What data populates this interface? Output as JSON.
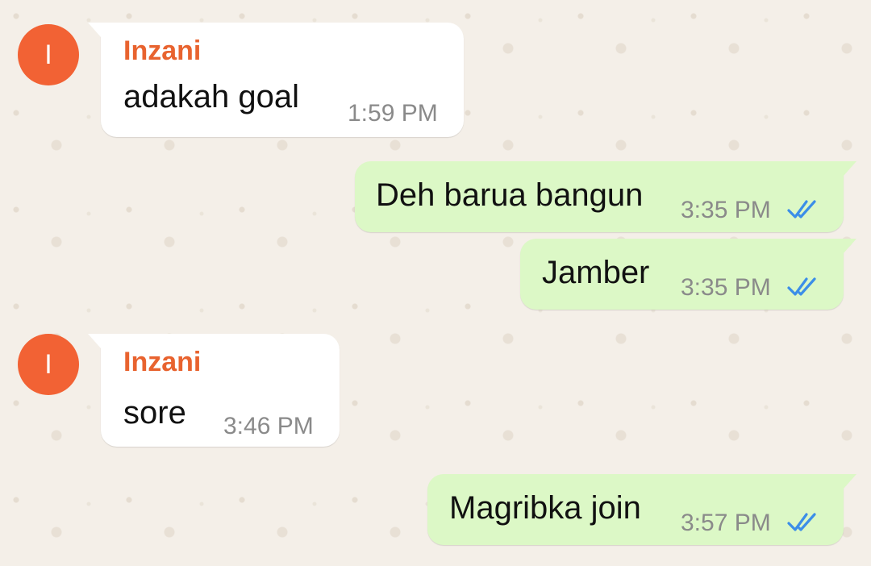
{
  "chat": {
    "messages": [
      {
        "direction": "in",
        "avatar_letter": "I",
        "sender": "Inzani",
        "text": "adakah goal",
        "time": "1:59 PM"
      },
      {
        "direction": "out",
        "text": "Deh barua bangun",
        "time": "3:35 PM",
        "status_icon": "double-check-icon"
      },
      {
        "direction": "out",
        "text": "Jamber",
        "time": "3:35 PM",
        "status_icon": "double-check-icon"
      },
      {
        "direction": "in",
        "avatar_letter": "I",
        "sender": "Inzani",
        "text": "sore",
        "time": "3:46 PM"
      },
      {
        "direction": "out",
        "text": "Magribka join",
        "time": "3:57 PM",
        "status_icon": "double-check-icon"
      }
    ]
  },
  "colors": {
    "background": "#f4efe8",
    "incoming_bubble": "#ffffff",
    "outgoing_bubble": "#dcf8c6",
    "avatar": "#f26234",
    "sender_name": "#e8632f",
    "read_ticks": "#3b8ee8"
  }
}
